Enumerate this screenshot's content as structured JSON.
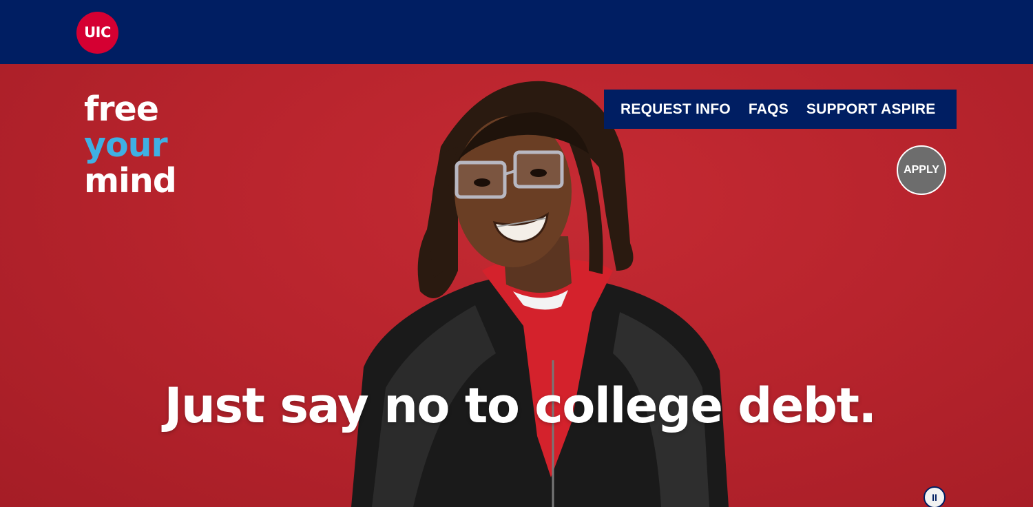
{
  "header": {
    "logo_text": "UIC",
    "colors": {
      "navy": "#001e62",
      "red": "#d50032"
    }
  },
  "hero": {
    "tagline": {
      "line1": "free",
      "line2": "your",
      "line3": "mind"
    },
    "headline": "Just say no to college debt.",
    "background_color": "#b8242d"
  },
  "nav": {
    "items": [
      {
        "label": "REQUEST INFO"
      },
      {
        "label": "FAQS"
      },
      {
        "label": "SUPPORT ASPIRE"
      }
    ]
  },
  "apply_button": {
    "label": "APPLY"
  },
  "media_controls": {
    "pause_icon": "pause-icon",
    "pause_glyph": "II"
  }
}
